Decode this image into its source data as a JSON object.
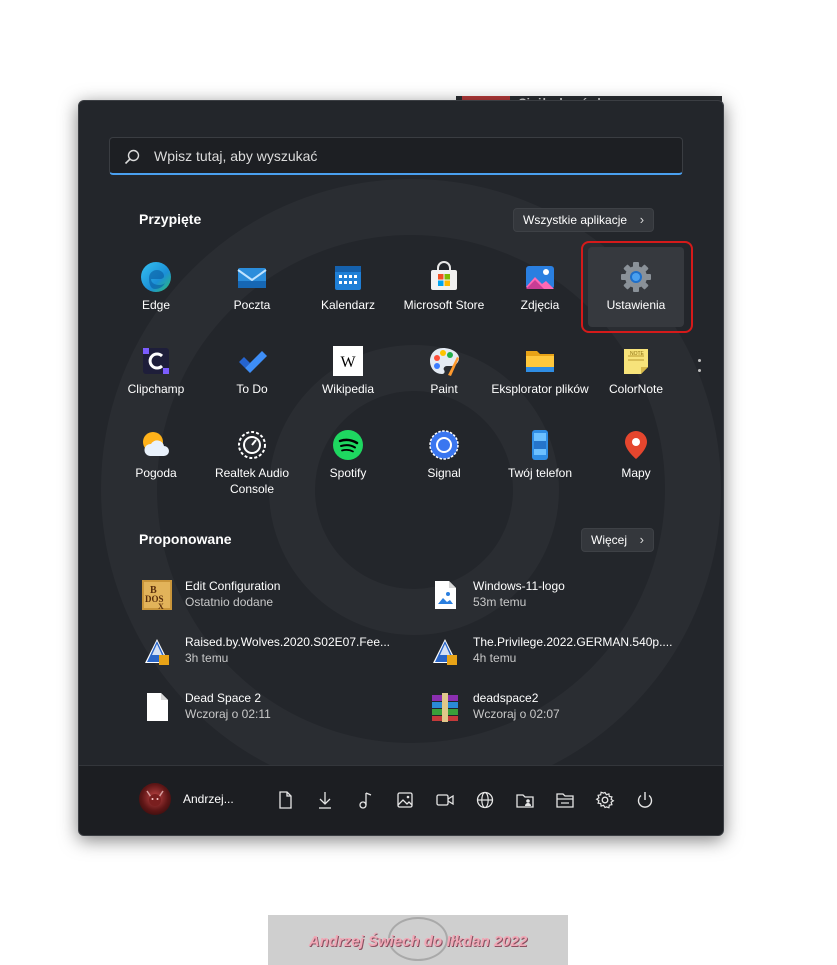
{
  "background_window": {
    "title": "Ciężka banówka"
  },
  "search": {
    "placeholder": "Wpisz tutaj, aby wyszukać"
  },
  "pinned": {
    "title": "Przypięte",
    "all_apps_label": "Wszystkie aplikacje",
    "apps": [
      {
        "label": "Edge",
        "icon": "edge-icon"
      },
      {
        "label": "Poczta",
        "icon": "mail-icon"
      },
      {
        "label": "Kalendarz",
        "icon": "calendar-icon"
      },
      {
        "label": "Microsoft Store",
        "icon": "store-icon"
      },
      {
        "label": "Zdjęcia",
        "icon": "photos-icon"
      },
      {
        "label": "Ustawienia",
        "icon": "settings-gear-icon"
      },
      {
        "label": "Clipchamp",
        "icon": "clipchamp-icon"
      },
      {
        "label": "To Do",
        "icon": "todo-check-icon"
      },
      {
        "label": "Wikipedia",
        "icon": "wikipedia-icon"
      },
      {
        "label": "Paint",
        "icon": "paint-palette-icon"
      },
      {
        "label": "Eksplorator plików",
        "icon": "folder-icon"
      },
      {
        "label": "ColorNote",
        "icon": "note-icon"
      },
      {
        "label": "Pogoda",
        "icon": "weather-icon"
      },
      {
        "label": "Realtek Audio Console",
        "icon": "audio-dial-icon"
      },
      {
        "label": "Spotify",
        "icon": "spotify-icon"
      },
      {
        "label": "Signal",
        "icon": "signal-icon"
      },
      {
        "label": "Twój telefon",
        "icon": "phone-icon"
      },
      {
        "label": "Mapy",
        "icon": "map-pin-icon"
      }
    ]
  },
  "recommended": {
    "title": "Proponowane",
    "more_label": "Więcej",
    "items": [
      {
        "name": "Edit Configuration",
        "time": "Ostatnio dodane",
        "icon": "dosbox-icon"
      },
      {
        "name": "Windows-11-logo",
        "time": "53m temu",
        "icon": "image-file-icon"
      },
      {
        "name": "Raised.by.Wolves.2020.S02E07.Fee...",
        "time": "3h temu",
        "icon": "vlc-media-icon"
      },
      {
        "name": "The.Privilege.2022.GERMAN.540p....",
        "time": "4h temu",
        "icon": "vlc-media-icon"
      },
      {
        "name": "Dead Space 2",
        "time": "Wczoraj o 02:11",
        "icon": "blank-file-icon"
      },
      {
        "name": "deadspace2",
        "time": "Wczoraj o 02:07",
        "icon": "winrar-icon"
      }
    ]
  },
  "bottom": {
    "user_name": "Andrzej...",
    "icons": [
      "documents-icon",
      "downloads-icon",
      "music-icon",
      "pictures-icon",
      "videos-icon",
      "network-icon",
      "personal-folder-icon",
      "file-explorer-icon",
      "settings-icon",
      "power-icon"
    ]
  },
  "watermark": {
    "text": "Andrzej Świech do Iłkdan 2022"
  },
  "colors": {
    "menu_bg": "#23262b",
    "accent": "#4aa0f0",
    "highlight": "#d51a1a"
  }
}
